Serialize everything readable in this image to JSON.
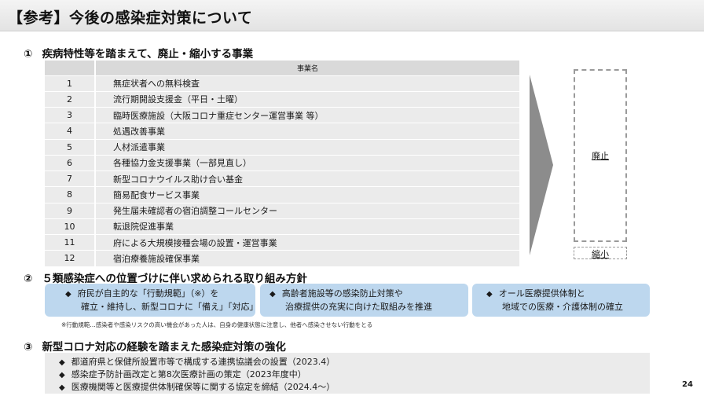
{
  "title": "【参考】今後の感染症対策について",
  "section1": {
    "number": "①",
    "heading": "疾病特性等を踏まえて、廃止・縮小する事業",
    "column_header": "事業名",
    "rows": [
      {
        "no": "1",
        "name": "無症状者への無料検査"
      },
      {
        "no": "2",
        "name": "流行期開設支援金（平日・土曜）"
      },
      {
        "no": "3",
        "name": "臨時医療施設（大阪コロナ重症センター運営事業 等）"
      },
      {
        "no": "4",
        "name": "処遇改善事業"
      },
      {
        "no": "5",
        "name": "人材派遣事業"
      },
      {
        "no": "6",
        "name": "各種協力金支援事業（一部見直し）"
      },
      {
        "no": "7",
        "name": "新型コロナウイルス助け合い基金"
      },
      {
        "no": "8",
        "name": "簡易配食サービス事業"
      },
      {
        "no": "9",
        "name": "発生届未確認者の宿泊調整コールセンター"
      },
      {
        "no": "10",
        "name": "転退院促進事業"
      },
      {
        "no": "11",
        "name": "府による大規模接種会場の設置・運営事業"
      },
      {
        "no": "12",
        "name": "宿泊療養施設確保事業"
      }
    ],
    "box_abolish": "廃止",
    "box_reduce": "縮小"
  },
  "section2": {
    "number": "②",
    "heading": "５類感染症への位置づけに伴い求められる取り組み方針",
    "bullet": "◆",
    "pills": [
      {
        "line1": "府民が自主的な「行動規範」（※）を",
        "line2": "確立・維持し、新型コロナに「備え」「対応」"
      },
      {
        "line1": "高齢者施設等の感染防止対策や",
        "line2": "治療提供の充実に向けた取組みを推進"
      },
      {
        "line1": "オール医療提供体制と",
        "line2": "地域での医療・介護体制の確立"
      }
    ],
    "note": "※行動規範…感染者や感染リスクの高い機会があった人は、自身の健康状態に注意し、他者へ感染させない行動をとる"
  },
  "section3": {
    "number": "③",
    "heading": "新型コロナ対応の経験を踏まえた感染症対策の強化",
    "bullet": "◆",
    "items": [
      "都道府県と保健所設置市等で構成する連携協議会の設置（2023.4）",
      "感染症予防計画改定と第8次医療計画の策定（2023年度中）",
      "医療機関等と医療提供体制確保等に関する協定を締結（2024.4～）"
    ]
  },
  "page_number": "24"
}
